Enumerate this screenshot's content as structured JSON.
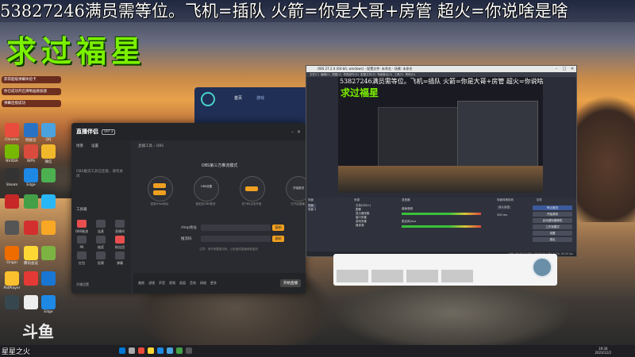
{
  "marquee": "53827246满员需等位。飞机=插队  火箭=你是大哥+房管  超火=你说啥是啥",
  "overlay_title": "求过福星",
  "notifications": [
    "获得超级弹幕体验卡",
    "你已成功开启清晰画质加速",
    "弹幕连接成功"
  ],
  "desktop_icons": [
    "Chrome",
    "网易云",
    "QQ",
    "微信",
    "NVIDIA",
    "WPS",
    "Steam",
    "Edge",
    "Origin",
    "腾讯会议",
    "PotPlayer",
    "Edge"
  ],
  "app": {
    "logo": "直播伴侣",
    "vip": "VIP 3",
    "side_tabs": [
      "场景",
      "设置"
    ],
    "side_hint": "OBS推流工具已连接，请勿关闭",
    "tools_title": "工具箱",
    "tools": [
      "OBS推流",
      "连麦",
      "直播间",
      "PK",
      "抽奖",
      "粉丝团",
      "红包",
      "投票",
      "弹幕"
    ],
    "settings_link": "开播设置",
    "breadcrumb": [
      "直播工具",
      "OBS"
    ],
    "relay_title": "OBS第三方推流模式",
    "steps": [
      "第一步",
      "OBS设置",
      "推流地址",
      "开始推流"
    ],
    "step_labels": [
      "复制rtmp地址",
      "粘贴至OBS推流",
      "在OBS点击开始",
      "已开启直播"
    ],
    "rtmp_label": "rtmp地址",
    "key_label": "推流码",
    "copy_label": "复制",
    "notice": "注意：请勿泄露推流码，以免造成直播间被盗用",
    "footer_items": [
      "美颜",
      "滤镜",
      "声音",
      "视频",
      "画面",
      "音效",
      "网络",
      "更多"
    ],
    "live_button": "开始直播"
  },
  "blue_app": {
    "tabs": [
      "首页",
      "游戏"
    ]
  },
  "obs": {
    "title": "OBS 27.2.4 (64-bit, windows) - 配置文件: 未命名 - 场景: 未命名",
    "menu": [
      "文件(F)",
      "编辑(E)",
      "视图(V)",
      "停靠部件(D)",
      "配置文件(P)",
      "场景集合(S)",
      "工具(T)",
      "帮助(H)"
    ],
    "preview_ticker": "53827246满员需等位。飞机=插队  火箭=你是大哥+房管  超火=你说啥是啥",
    "preview_title": "求过福星",
    "dock_heads": [
      "场景",
      "来源",
      "混音器",
      "场景转换特效",
      "控件"
    ],
    "scenes": [
      "场景",
      "场景 2"
    ],
    "sources": [
      "文本(GDI+)",
      "图像",
      "显示器采集",
      "窗口采集",
      "游戏采集",
      "媒体源"
    ],
    "mixer": [
      "桌面音频",
      "麦克风/Aux"
    ],
    "transition": "淡入淡出",
    "duration": "300 ms",
    "controls": [
      "停止推流",
      "开始录制",
      "启动虚拟摄像机",
      "工作室模式",
      "设置",
      "退出"
    ],
    "status": "LIVE: 00:25:21   REC: 00:00:00   CPU: 6.7%, 60.00 fps"
  },
  "taskbar": {
    "left_text": "星星之火",
    "clock_time": "19:36",
    "clock_date": "2023/12/2"
  },
  "watermark": "斗鱼"
}
